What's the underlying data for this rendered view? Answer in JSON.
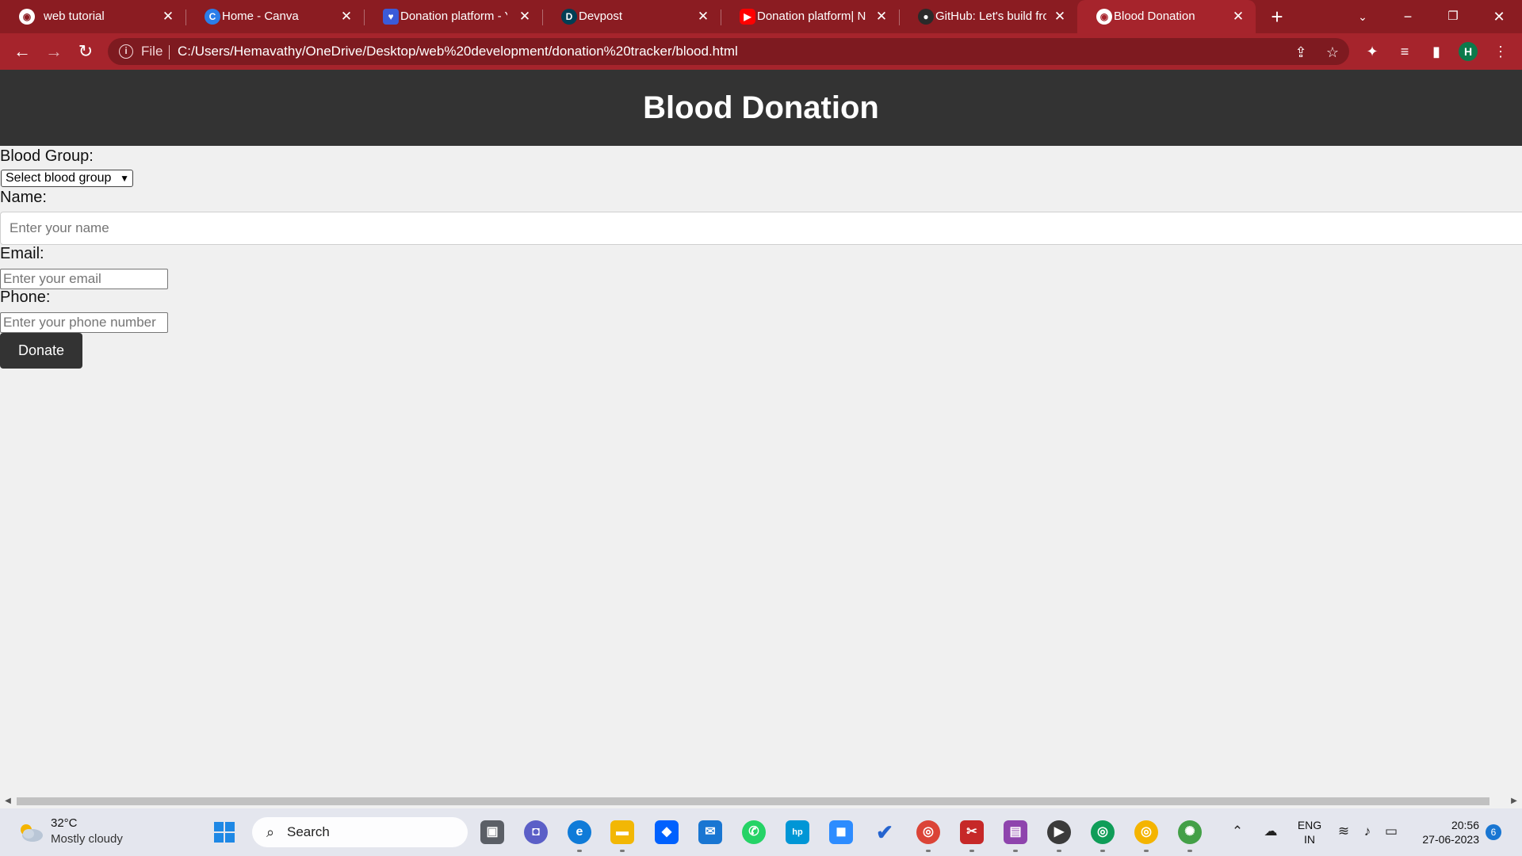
{
  "browser": {
    "tabs": [
      {
        "title": "web tutorial",
        "icon": "globe-icon",
        "active": false
      },
      {
        "title": "Home - Canva",
        "icon": "canva-icon",
        "active": false
      },
      {
        "title": "Donation platform - Y",
        "icon": "heart-icon",
        "active": false
      },
      {
        "title": "Devpost",
        "icon": "devpost-icon",
        "active": false
      },
      {
        "title": "Donation platform| N",
        "icon": "youtube-icon",
        "active": false
      },
      {
        "title": "GitHub: Let's build fro",
        "icon": "github-icon",
        "active": false
      },
      {
        "title": "Blood Donation",
        "icon": "globe-icon",
        "active": true
      }
    ],
    "close_glyph": "✕",
    "new_tab_glyph": "+",
    "address": {
      "scheme": "File",
      "url": "C:/Users/Hemavathy/OneDrive/Desktop/web%20development/donation%20tracker/blood.html"
    },
    "profile_initial": "H",
    "accent": "#a6242c"
  },
  "page": {
    "title": "Blood Donation",
    "form": {
      "blood_group_label": "Blood Group:",
      "blood_group_selected": "Select blood group",
      "name_label": "Name:",
      "name_placeholder": "Enter your name",
      "email_label": "Email:",
      "email_placeholder": "Enter your email",
      "phone_label": "Phone:",
      "phone_placeholder": "Enter your phone number",
      "submit_label": "Donate"
    },
    "header_color": "#333333"
  },
  "taskbar": {
    "weather": {
      "temp": "32°C",
      "desc": "Mostly cloudy"
    },
    "search_label": "Search",
    "lang": {
      "line1": "ENG",
      "line2": "IN"
    },
    "clock": {
      "time": "20:56",
      "date": "27-06-2023"
    },
    "notification_count": "6",
    "profile_badge": "H"
  }
}
